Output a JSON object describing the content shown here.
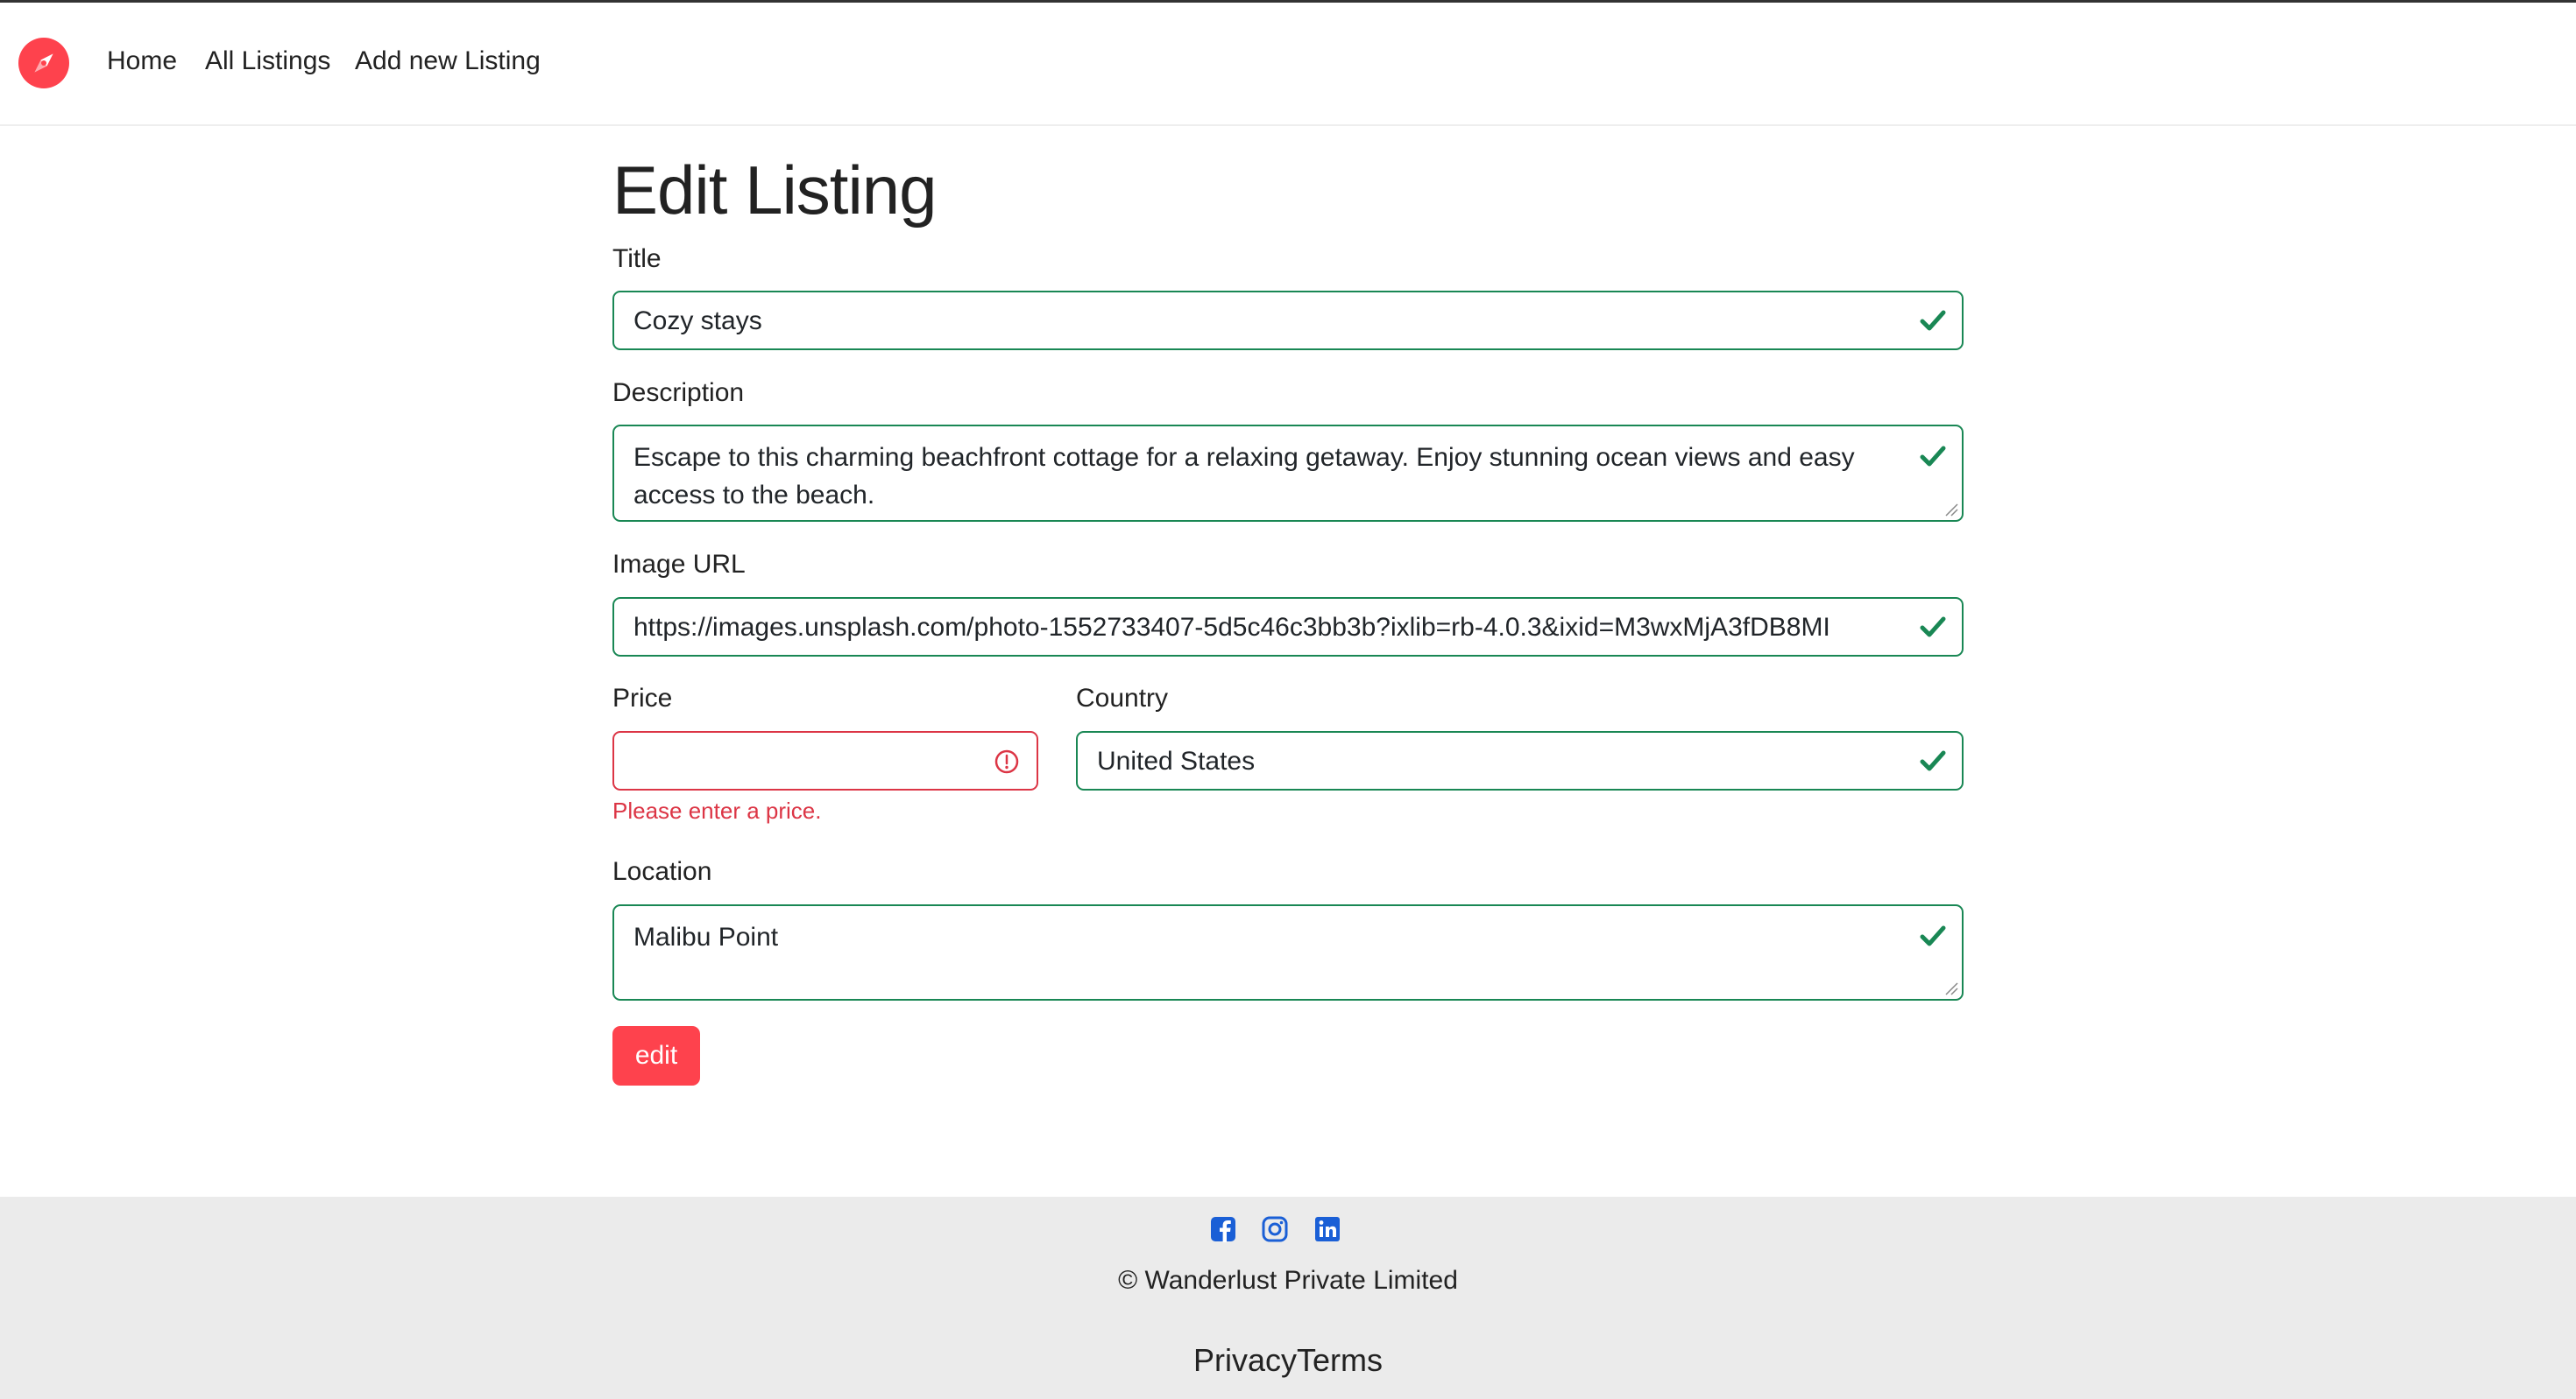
{
  "nav": {
    "brand_icon": "compass-icon",
    "links": [
      "Home",
      "All Listings",
      "Add new Listing"
    ]
  },
  "form": {
    "heading": "Edit Listing",
    "title": {
      "label": "Title",
      "value": "Cozy stays"
    },
    "description": {
      "label": "Description",
      "value": "Escape to this charming beachfront cottage for a relaxing getaway. Enjoy stunning ocean views and easy access to the beach."
    },
    "image_url": {
      "label": "Image URL",
      "value": "https://images.unsplash.com/photo-1552733407-5d5c46c3bb3b?ixlib=rb-4.0.3&ixid=M3wxMjA3fDB8MI"
    },
    "price": {
      "label": "Price",
      "value": "",
      "error": "Please enter a price."
    },
    "country": {
      "label": "Country",
      "value": "United States"
    },
    "location": {
      "label": "Location",
      "value": "Malibu Point"
    },
    "submit_label": "edit"
  },
  "footer": {
    "social_icons": [
      "facebook-icon",
      "instagram-icon",
      "linkedin-icon"
    ],
    "copyright": "© Wanderlust Private Limited",
    "links": [
      "Privacy",
      "Terms"
    ]
  },
  "colors": {
    "brand": "#fe424d",
    "valid": "#198754",
    "invalid": "#dc3545",
    "social": "#1a5fd6",
    "footer_bg": "#ebebeb"
  }
}
